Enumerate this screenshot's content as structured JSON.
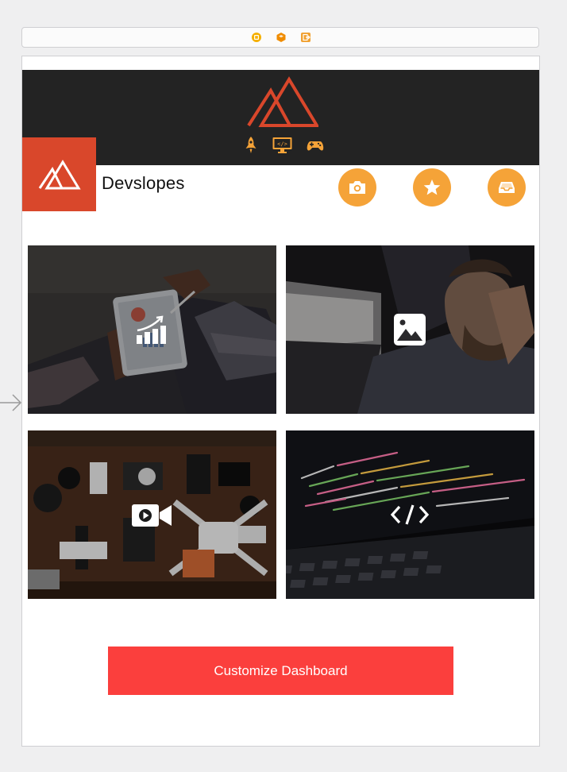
{
  "scene_dock": {
    "icons": [
      "view-controller-icon",
      "first-responder-icon",
      "exit-icon"
    ],
    "colors": {
      "controller": "#f5b000",
      "responder": "#f08c00",
      "exit": "#f0a030"
    }
  },
  "header": {
    "logo_icon": "mountain-logo-icon",
    "category_icons": [
      "rocket-icon",
      "monitor-code-icon",
      "gamepad-icon"
    ]
  },
  "brand": {
    "name": "Devslopes",
    "logo_icon": "mountain-logo-icon",
    "logo_color": "#d9472b"
  },
  "action_buttons": [
    {
      "name": "camera-button",
      "icon": "camera-icon"
    },
    {
      "name": "favorites-button",
      "icon": "star-icon"
    },
    {
      "name": "inbox-button",
      "icon": "inbox-tray-icon"
    }
  ],
  "accent_color": "#f5a338",
  "tiles": [
    {
      "name": "analytics-tile",
      "icon": "bar-chart-growth-icon"
    },
    {
      "name": "photos-tile",
      "icon": "image-icon"
    },
    {
      "name": "videos-tile",
      "icon": "video-camera-icon"
    },
    {
      "name": "code-tile",
      "icon": "code-brackets-icon"
    }
  ],
  "cta": {
    "label": "Customize Dashboard",
    "color": "#fb3f3d"
  }
}
